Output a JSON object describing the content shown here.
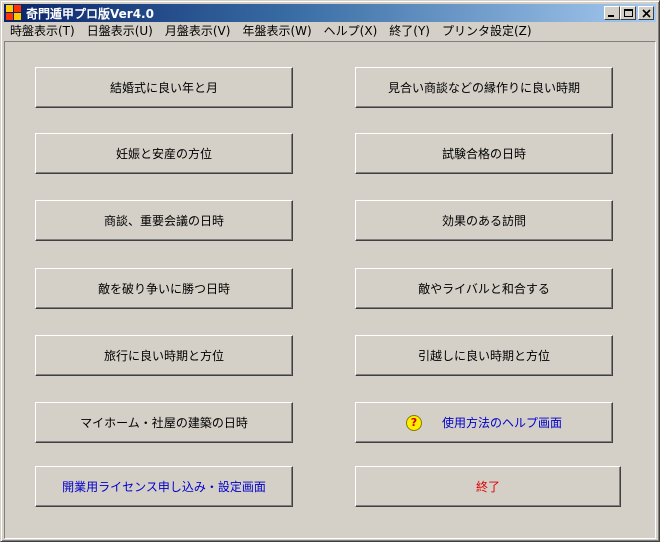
{
  "window": {
    "title": "奇門遁甲プロ版Ver4.0"
  },
  "menu": [
    "時盤表示(T)",
    "日盤表示(U)",
    "月盤表示(V)",
    "年盤表示(W)",
    "ヘルプ(X)",
    "終了(Y)",
    "プリンタ設定(Z)"
  ],
  "buttons": {
    "marriage": "結婚式に良い年と月",
    "matchmaking": "見合い商談などの縁作りに良い時期",
    "pregnancy": "妊娠と安産の方位",
    "exam": "試験合格の日時",
    "business_meeting": "商談、重要会議の日時",
    "visit": "効果のある訪問",
    "defeat_enemy": "敵を破り争いに勝つ日時",
    "reconcile": "敵やライバルと和合する",
    "travel": "旅行に良い時期と方位",
    "moving": "引越しに良い時期と方位",
    "house_building": "マイホーム・社屋の建築の日時",
    "help": "使用方法のヘルプ画面",
    "license": "開業用ライセンス申し込み・設定画面",
    "exit": "終了"
  },
  "icons": {
    "help_icon_glyph": "?"
  },
  "colors": {
    "titlebar_start": "#0a246a",
    "titlebar_end": "#a6caf0",
    "face": "#d4d0c8",
    "blue_text": "#0000cc",
    "red_text": "#e00000"
  }
}
